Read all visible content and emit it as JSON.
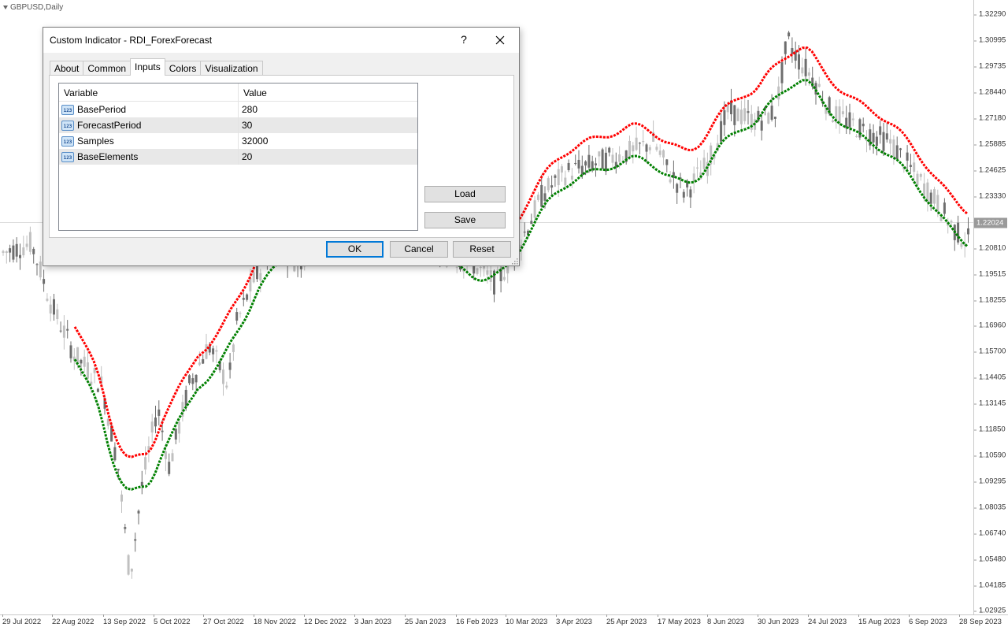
{
  "chart": {
    "symbol": "GBPUSD,Daily",
    "current_price": "1.22024",
    "price_ticks": [
      "1.32290",
      "1.30995",
      "1.29735",
      "1.28440",
      "1.27180",
      "1.25885",
      "1.24625",
      "1.23330",
      "1.22024",
      "1.20810",
      "1.19515",
      "1.18255",
      "1.16960",
      "1.15700",
      "1.14405",
      "1.13145",
      "1.11850",
      "1.10590",
      "1.09295",
      "1.08035",
      "1.06740",
      "1.05480",
      "1.04185",
      "1.02925"
    ],
    "time_ticks": [
      "29 Jul 2022",
      "22 Aug 2022",
      "13 Sep 2022",
      "5 Oct 2022",
      "27 Oct 2022",
      "18 Nov 2022",
      "12 Dec 2022",
      "3 Jan 2023",
      "25 Jan 2023",
      "16 Feb 2023",
      "10 Mar 2023",
      "3 Apr 2023",
      "25 Apr 2023",
      "17 May 2023",
      "8 Jun 2023",
      "30 Jun 2023",
      "24 Jul 2023",
      "15 Aug 2023",
      "6 Sep 2023",
      "28 Sep 2023"
    ],
    "colors": {
      "bull_candle": "#c0c0c0",
      "bear_candle": "#6e6e6e",
      "upper_band": "#ff0000",
      "lower_band": "#008000"
    }
  },
  "dialog": {
    "title": "Custom Indicator - RDI_ForexForecast",
    "help_label": "?",
    "tabs": [
      {
        "label": "About"
      },
      {
        "label": "Common"
      },
      {
        "label": "Inputs"
      },
      {
        "label": "Colors"
      },
      {
        "label": "Visualization"
      }
    ],
    "active_tab": "Inputs",
    "table": {
      "headers": {
        "variable": "Variable",
        "value": "Value"
      },
      "rows": [
        {
          "variable": "BasePeriod",
          "value": "280"
        },
        {
          "variable": "ForecastPeriod",
          "value": "30"
        },
        {
          "variable": "Samples",
          "value": "32000"
        },
        {
          "variable": "BaseElements",
          "value": "20"
        }
      ],
      "icon_text": "123"
    },
    "buttons": {
      "load": "Load",
      "save": "Save",
      "ok": "OK",
      "cancel": "Cancel",
      "reset": "Reset"
    }
  }
}
